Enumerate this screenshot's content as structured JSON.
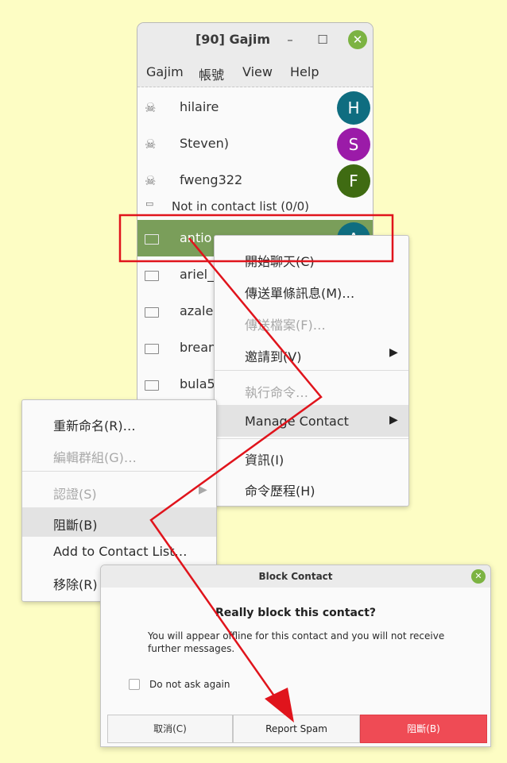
{
  "window": {
    "title": "[90]  Gajim",
    "minimize": "–",
    "maximize": "☐",
    "close": "✕"
  },
  "menubar": [
    "Gajim",
    "帳號",
    "View",
    "Help"
  ],
  "contacts": [
    {
      "name": "hilaire",
      "initial": "H",
      "color": "#0f6d80"
    },
    {
      "name": "Steven)",
      "initial": "S",
      "color": "#9b1ba8"
    },
    {
      "name": "fweng322",
      "initial": "F",
      "color": "#3f6b12"
    }
  ],
  "group": {
    "label": "Not in contact list (0/0)",
    "toggle": "▭"
  },
  "unlisted": [
    {
      "name": "antio",
      "initial": "A",
      "color": "#0f6d80"
    },
    {
      "name": "ariel_"
    },
    {
      "name": "azale"
    },
    {
      "name": "brean"
    },
    {
      "name": "bula5"
    }
  ],
  "context_menu": {
    "items": [
      {
        "label": "開始聊天(C)",
        "disabled": false
      },
      {
        "label": "傳送單條訊息(M)…",
        "disabled": false
      },
      {
        "label": "傳送檔案(F)…",
        "disabled": true
      },
      {
        "label": "邀請到(V)",
        "disabled": false,
        "arrow": "▶"
      },
      {
        "label": "執行命令…",
        "disabled": true
      },
      {
        "label": "Manage Contact",
        "disabled": false,
        "arrow": "▶"
      },
      {
        "label": "資訊(I)",
        "disabled": false
      },
      {
        "label": "命令歷程(H)",
        "disabled": false
      }
    ]
  },
  "submenu": {
    "items": [
      {
        "label": "重新命名(R)…",
        "disabled": false
      },
      {
        "label": "編輯群組(G)…",
        "disabled": true
      },
      {
        "label": "認證(S)",
        "disabled": true,
        "arrow": "▶"
      },
      {
        "label": "阻斷(B)",
        "disabled": false
      },
      {
        "label": "Add to Contact List…",
        "disabled": false
      },
      {
        "label": "移除(R)",
        "disabled": false
      }
    ]
  },
  "dialog": {
    "title": "Block Contact",
    "close": "✕",
    "heading": "Really block this contact?",
    "message": "You will appear offline for this contact and you will not receive further messages.",
    "checkbox_label": "Do not ask again",
    "cancel": "取消(C)",
    "report_spam": "Report Spam",
    "block": "阻斷(B)"
  },
  "colors": {
    "annotation": "#e0141c",
    "highlight_row": "#7a9e5a",
    "block_button": "#ef4b55"
  }
}
